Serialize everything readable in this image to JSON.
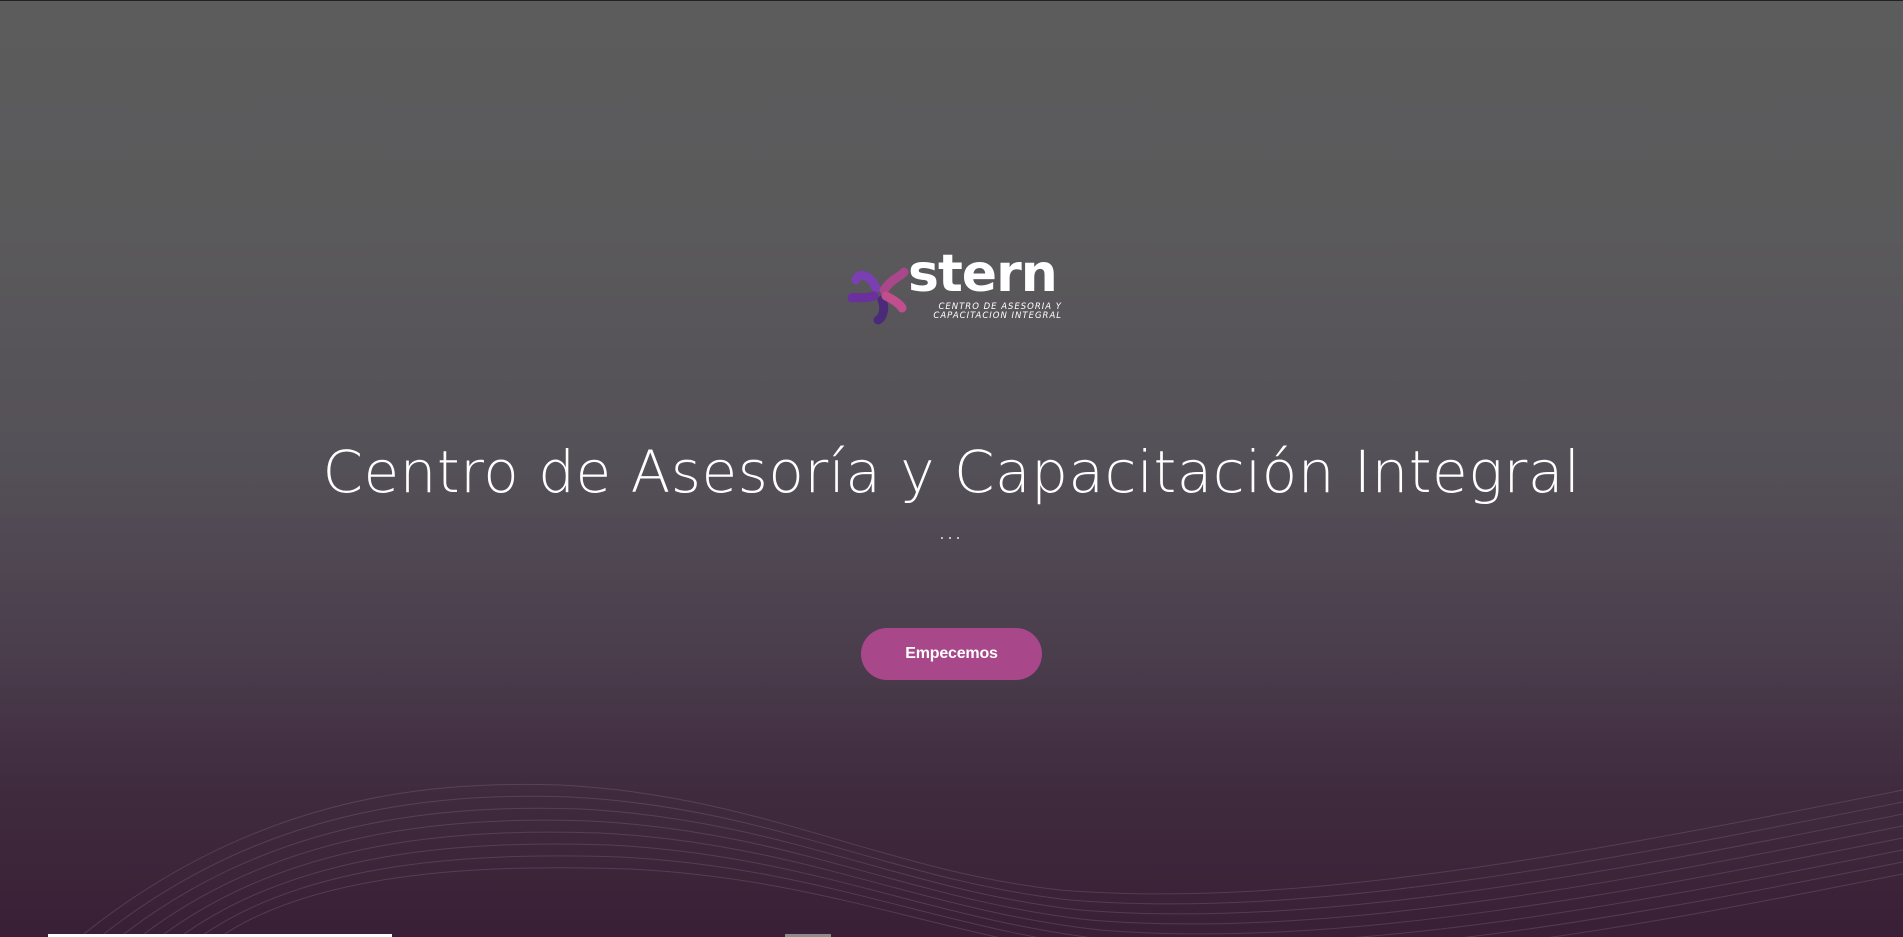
{
  "logo": {
    "wordmark": "stern",
    "tagline_line1": "CENTRO DE ASESORIA Y",
    "tagline_line2": "CAPACITACION INTEGRAL",
    "colors": [
      "#6b2f9e",
      "#a8478a",
      "#4b2a7a"
    ]
  },
  "hero": {
    "title": "Centro de Asesoría y Capacitación Integral",
    "subtitle": "...",
    "cta_label": "Empecemos"
  },
  "colors": {
    "cta_background": "#a8478a",
    "background_top": "#5c5c5c",
    "background_bottom": "#3a1f36"
  }
}
